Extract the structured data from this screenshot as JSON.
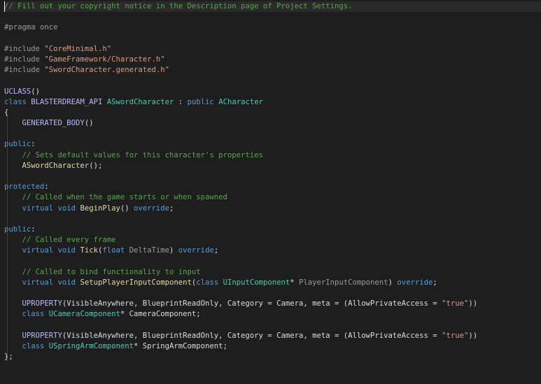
{
  "editor": {
    "language": "C++",
    "lines": [
      [
        {
          "t": "// Fill out your copyright notice in the Description page of Project Settings.",
          "c": "comment"
        }
      ],
      [],
      [
        {
          "t": "#pragma once",
          "c": "prep"
        }
      ],
      [],
      [
        {
          "t": "#include ",
          "c": "prep"
        },
        {
          "t": "\"CoreMinimal.h\"",
          "c": "string"
        }
      ],
      [
        {
          "t": "#include ",
          "c": "prep"
        },
        {
          "t": "\"GameFramework/Character.h\"",
          "c": "string"
        }
      ],
      [
        {
          "t": "#include ",
          "c": "prep"
        },
        {
          "t": "\"SwordCharacter.generated.h\"",
          "c": "string"
        }
      ],
      [],
      [
        {
          "t": "UCLASS",
          "c": "macro"
        },
        {
          "t": "()",
          "c": "plain"
        }
      ],
      [
        {
          "t": "class ",
          "c": "kw"
        },
        {
          "t": "BLASTERDREAM_API ",
          "c": "macro"
        },
        {
          "t": "ASwordCharacter",
          "c": "type"
        },
        {
          "t": " : ",
          "c": "plain"
        },
        {
          "t": "public ",
          "c": "kw"
        },
        {
          "t": "ACharacter",
          "c": "type"
        }
      ],
      [
        {
          "t": "{",
          "c": "plain"
        }
      ],
      [
        {
          "t": "    ",
          "c": "plain"
        },
        {
          "t": "GENERATED_BODY",
          "c": "macro"
        },
        {
          "t": "()",
          "c": "plain"
        }
      ],
      [],
      [
        {
          "t": "public",
          "c": "kw"
        },
        {
          "t": ":",
          "c": "plain"
        }
      ],
      [
        {
          "t": "    ",
          "c": "plain"
        },
        {
          "t": "// Sets default values for this character's properties",
          "c": "comment"
        }
      ],
      [
        {
          "t": "    ",
          "c": "plain"
        },
        {
          "t": "ASwordCharacter",
          "c": "func"
        },
        {
          "t": "();",
          "c": "plain"
        }
      ],
      [],
      [
        {
          "t": "protected",
          "c": "kw"
        },
        {
          "t": ":",
          "c": "plain"
        }
      ],
      [
        {
          "t": "    ",
          "c": "plain"
        },
        {
          "t": "// Called when the game starts or when spawned",
          "c": "comment"
        }
      ],
      [
        {
          "t": "    ",
          "c": "plain"
        },
        {
          "t": "virtual ",
          "c": "kw"
        },
        {
          "t": "void ",
          "c": "kw"
        },
        {
          "t": "BeginPlay",
          "c": "func"
        },
        {
          "t": "() ",
          "c": "plain"
        },
        {
          "t": "override",
          "c": "kw"
        },
        {
          "t": ";",
          "c": "plain"
        }
      ],
      [],
      [
        {
          "t": "public",
          "c": "kw"
        },
        {
          "t": ":",
          "c": "plain"
        }
      ],
      [
        {
          "t": "    ",
          "c": "plain"
        },
        {
          "t": "// Called every frame",
          "c": "comment"
        }
      ],
      [
        {
          "t": "    ",
          "c": "plain"
        },
        {
          "t": "virtual ",
          "c": "kw"
        },
        {
          "t": "void ",
          "c": "kw"
        },
        {
          "t": "Tick",
          "c": "func"
        },
        {
          "t": "(",
          "c": "plain"
        },
        {
          "t": "float ",
          "c": "kw"
        },
        {
          "t": "DeltaTime",
          "c": "param"
        },
        {
          "t": ") ",
          "c": "plain"
        },
        {
          "t": "override",
          "c": "kw"
        },
        {
          "t": ";",
          "c": "plain"
        }
      ],
      [],
      [
        {
          "t": "    ",
          "c": "plain"
        },
        {
          "t": "// Called to bind functionality to input",
          "c": "comment"
        }
      ],
      [
        {
          "t": "    ",
          "c": "plain"
        },
        {
          "t": "virtual ",
          "c": "kw"
        },
        {
          "t": "void ",
          "c": "kw"
        },
        {
          "t": "SetupPlayerInputComponent",
          "c": "func"
        },
        {
          "t": "(",
          "c": "plain"
        },
        {
          "t": "class ",
          "c": "kw"
        },
        {
          "t": "UInputComponent",
          "c": "type"
        },
        {
          "t": "* ",
          "c": "plain"
        },
        {
          "t": "PlayerInputComponent",
          "c": "param"
        },
        {
          "t": ") ",
          "c": "plain"
        },
        {
          "t": "override",
          "c": "kw"
        },
        {
          "t": ";",
          "c": "plain"
        }
      ],
      [],
      [
        {
          "t": "    ",
          "c": "plain"
        },
        {
          "t": "UPROPERTY",
          "c": "macro"
        },
        {
          "t": "(VisibleAnywhere, BlueprintReadOnly, Category = Camera, meta = (AllowPrivateAccess = ",
          "c": "plain"
        },
        {
          "t": "\"true\"",
          "c": "string"
        },
        {
          "t": "))",
          "c": "plain"
        }
      ],
      [
        {
          "t": "    ",
          "c": "plain"
        },
        {
          "t": "class ",
          "c": "kw"
        },
        {
          "t": "UCameraComponent",
          "c": "type"
        },
        {
          "t": "* ",
          "c": "plain"
        },
        {
          "t": "CameraComponent",
          "c": "member"
        },
        {
          "t": ";",
          "c": "plain"
        }
      ],
      [],
      [
        {
          "t": "    ",
          "c": "plain"
        },
        {
          "t": "UPROPERTY",
          "c": "macro"
        },
        {
          "t": "(VisibleAnywhere, BlueprintReadOnly, Category = Camera, meta = (AllowPrivateAccess = ",
          "c": "plain"
        },
        {
          "t": "\"true\"",
          "c": "string"
        },
        {
          "t": "))",
          "c": "plain"
        }
      ],
      [
        {
          "t": "    ",
          "c": "plain"
        },
        {
          "t": "class ",
          "c": "kw"
        },
        {
          "t": "USpringArmComponent",
          "c": "type"
        },
        {
          "t": "* ",
          "c": "plain"
        },
        {
          "t": "SpringArmComponent",
          "c": "member"
        },
        {
          "t": ";",
          "c": "plain"
        }
      ],
      [
        {
          "t": "};",
          "c": "plain"
        }
      ]
    ]
  },
  "colors": {
    "background": "#1e1e1e",
    "comment": "#57a64a",
    "preprocessor": "#9b9b9b",
    "string": "#d69d85",
    "keyword": "#569cd6",
    "type": "#4ec9b0",
    "macro": "#beb7ff",
    "function": "#dcdcaa",
    "parameter": "#9a9a9a",
    "text": "#dcdcdc"
  },
  "fold_markers": [
    4,
    9
  ]
}
